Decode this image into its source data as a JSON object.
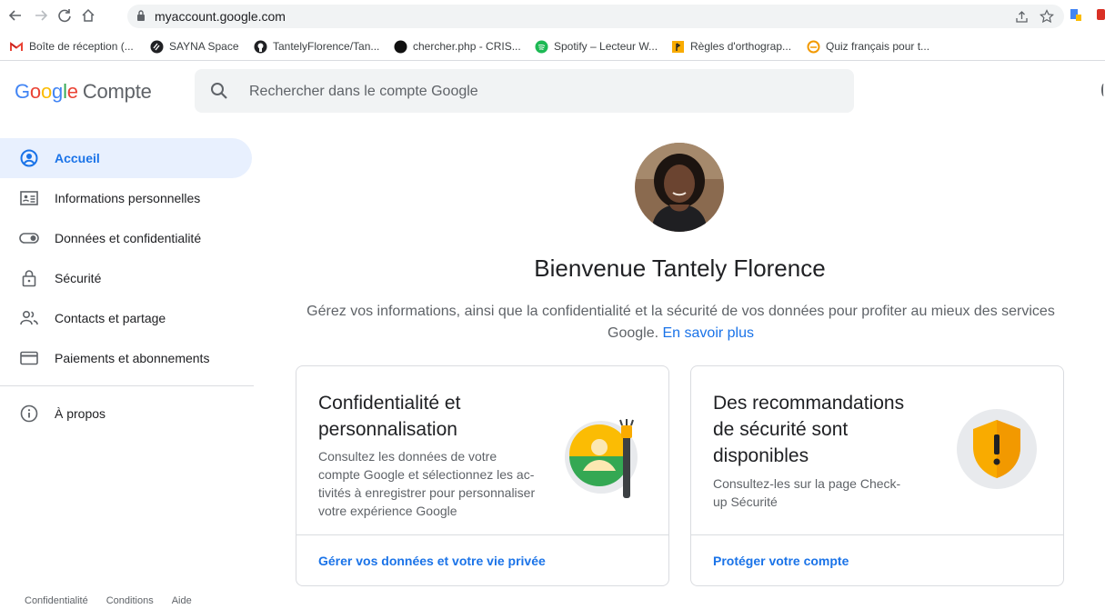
{
  "browser": {
    "url": "myaccount.google.com",
    "bookmarks": [
      {
        "label": "Boîte de réception (...",
        "icon": "gmail-icon"
      },
      {
        "label": "SAYNA Space",
        "icon": "sayna-icon"
      },
      {
        "label": "TantelyFlorence/Tan...",
        "icon": "github-icon"
      },
      {
        "label": "chercher.php - CRIS...",
        "icon": "cris-icon"
      },
      {
        "label": "Spotify – Lecteur W...",
        "icon": "spotify-icon"
      },
      {
        "label": "Règles d'orthograp...",
        "icon": "bookmark-favicon"
      },
      {
        "label": "Quiz français pour t...",
        "icon": "quiz-icon"
      }
    ]
  },
  "header": {
    "logo_google": "Google",
    "logo_product": "Compte",
    "search_placeholder": "Rechercher dans le compte Google"
  },
  "sidebar": {
    "items": [
      {
        "label": "Accueil",
        "icon": "account-circle-icon",
        "active": true
      },
      {
        "label": "Informations personnelles",
        "icon": "id-card-icon"
      },
      {
        "label": "Données et confidentialité",
        "icon": "toggle-icon"
      },
      {
        "label": "Sécurité",
        "icon": "lock-icon"
      },
      {
        "label": "Contacts et partage",
        "icon": "people-icon"
      },
      {
        "label": "Paiements et abonnements",
        "icon": "credit-card-icon"
      }
    ],
    "about": {
      "label": "À propos",
      "icon": "info-icon"
    }
  },
  "footer": {
    "links": [
      "Confidentialité",
      "Conditions",
      "Aide"
    ]
  },
  "main": {
    "welcome": "Bienvenue Tantely Florence",
    "intro_text": "Gérez vos informations, ainsi que la confidentialité et la sécurité de vos données pour profiter au mieux des services Google.",
    "intro_link": "En savoir plus",
    "cards": [
      {
        "title_line1": "Confidentialité et",
        "title_line2": "personnalisation",
        "desc_lines": [
          "Consultez les données de votre",
          "compte Google et sélectionnez les ac-",
          "tivités à enregistrer pour personnaliser",
          "votre expérience Google"
        ],
        "link": "Gérer vos données et votre vie privée"
      },
      {
        "title_line1": "Des recommandations",
        "title_line2": "de sécurité sont",
        "title_line3": "disponibles",
        "desc_lines": [
          "Consultez-les sur la page Check-",
          "up Sécurité"
        ],
        "link": "Protéger votre compte"
      }
    ]
  },
  "colors": {
    "accent": "#1a73e8",
    "active_bg": "#e8f0fe",
    "shield": "#f9ab00"
  }
}
